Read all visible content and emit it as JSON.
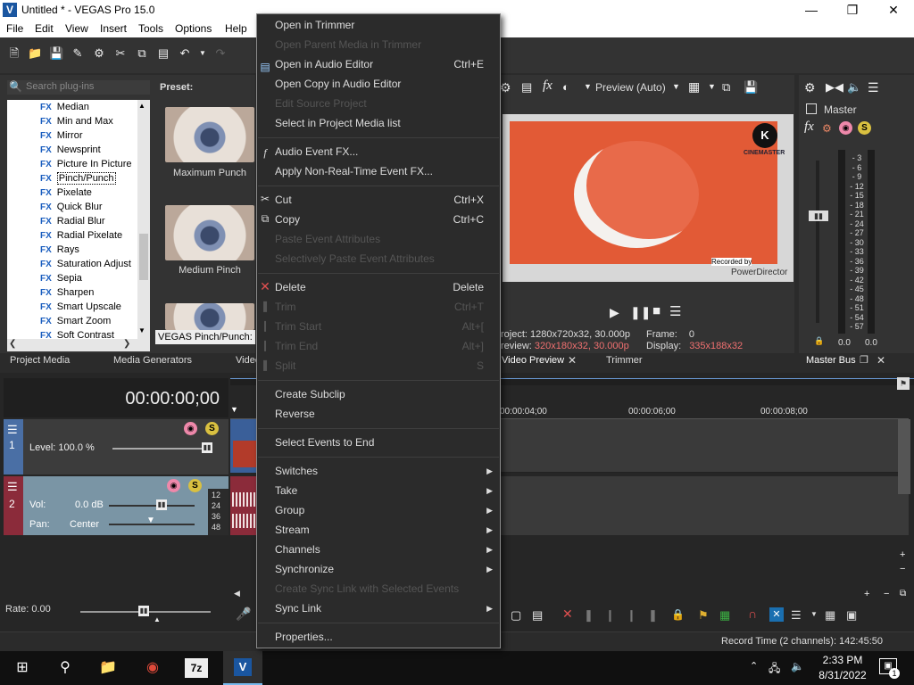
{
  "app": {
    "title": "Untitled * - VEGAS Pro 15.0"
  },
  "menubar": [
    "File",
    "Edit",
    "View",
    "Insert",
    "Tools",
    "Options",
    "Help"
  ],
  "plugins": {
    "search_placeholder": "Search plug-ins",
    "preset_label": "Preset:",
    "items": [
      "Median",
      "Min and Max",
      "Mirror",
      "Newsprint",
      "Picture In Picture",
      "Pinch/Punch",
      "Pixelate",
      "Quick Blur",
      "Radial Blur",
      "Radial Pixelate",
      "Rays",
      "Saturation Adjust",
      "Sepia",
      "Sharpen",
      "Smart Upscale",
      "Smart Zoom",
      "Soft Contrast"
    ],
    "selected": "Pinch/Punch",
    "presets": [
      "Maximum Punch",
      "Medium Pinch"
    ],
    "status": "VEGAS Pinch/Punch: D"
  },
  "left_tabs": [
    "Project Media",
    "Media Generators",
    "Video"
  ],
  "preview": {
    "quality": "Preview (Auto)",
    "watermark_text": "CINEMASTER",
    "recorded_by": "Recorded by",
    "powerdirector": "PowerDirector",
    "project_label": "roject:",
    "project_value": "1280x720x32, 30.000p",
    "frame_label": "Frame:",
    "frame_value": "0",
    "preview_label": "review:",
    "preview_value": "320x180x32, 30.000p",
    "display_label": "Display:",
    "display_value": "335x188x32",
    "tabs": [
      "Video Preview",
      "Trimmer"
    ]
  },
  "master": {
    "label": "Master",
    "scale": [
      "3",
      "6",
      "9",
      "12",
      "15",
      "18",
      "21",
      "24",
      "27",
      "30",
      "33",
      "36",
      "39",
      "42",
      "45",
      "48",
      "51",
      "54",
      "57"
    ],
    "left_value": "0.0",
    "right_value": "0.0",
    "tab": "Master Bus"
  },
  "timeline": {
    "timecode": "00:00:00;00",
    "ruler": [
      "00:00:04;00",
      "00:00:06;00",
      "00:00:08;00"
    ],
    "track1": {
      "level": "Level: 100.0 %"
    },
    "track2": {
      "vol_label": "Vol:",
      "vol_value": "0.0 dB",
      "pan_label": "Pan:",
      "pan_value": "Center",
      "scale": [
        "12",
        "24",
        "36",
        "48"
      ]
    },
    "rate": "Rate: 0.00"
  },
  "status": {
    "record_time": "Record Time (2 channels): 142:45:50"
  },
  "context_menu": {
    "items": [
      {
        "label": "Open in Trimmer",
        "enabled": true
      },
      {
        "label": "Open Parent Media in Trimmer",
        "enabled": false
      },
      {
        "label": "Open in Audio Editor",
        "shortcut": "Ctrl+E",
        "enabled": true
      },
      {
        "label": "Open Copy in Audio Editor",
        "enabled": true
      },
      {
        "label": "Edit Source Project",
        "enabled": false
      },
      {
        "label": "Select in Project Media list",
        "enabled": true
      },
      {
        "label": "Audio Event FX...",
        "enabled": true
      },
      {
        "label": "Apply Non-Real-Time Event FX...",
        "enabled": true
      },
      {
        "label": "Cut",
        "shortcut": "Ctrl+X",
        "enabled": true
      },
      {
        "label": "Copy",
        "shortcut": "Ctrl+C",
        "enabled": true
      },
      {
        "label": "Paste Event Attributes",
        "enabled": false
      },
      {
        "label": "Selectively Paste Event Attributes",
        "enabled": false
      },
      {
        "label": "Delete",
        "shortcut": "Delete",
        "enabled": true
      },
      {
        "label": "Trim",
        "shortcut": "Ctrl+T",
        "enabled": false
      },
      {
        "label": "Trim Start",
        "shortcut": "Alt+[",
        "enabled": false
      },
      {
        "label": "Trim End",
        "shortcut": "Alt+]",
        "enabled": false
      },
      {
        "label": "Split",
        "shortcut": "S",
        "enabled": false
      },
      {
        "label": "Create Subclip",
        "enabled": true
      },
      {
        "label": "Reverse",
        "enabled": true
      },
      {
        "label": "Select Events to End",
        "enabled": true
      },
      {
        "label": "Switches",
        "enabled": true
      },
      {
        "label": "Take",
        "enabled": true
      },
      {
        "label": "Group",
        "enabled": true
      },
      {
        "label": "Stream",
        "enabled": true
      },
      {
        "label": "Channels",
        "enabled": true
      },
      {
        "label": "Synchronize",
        "enabled": true
      },
      {
        "label": "Create Sync Link with Selected Events",
        "enabled": false
      },
      {
        "label": "Sync Link",
        "enabled": true
      },
      {
        "label": "Properties...",
        "enabled": true
      }
    ]
  },
  "taskbar": {
    "time": "2:33 PM",
    "date": "8/31/2022",
    "notif_count": "1"
  }
}
